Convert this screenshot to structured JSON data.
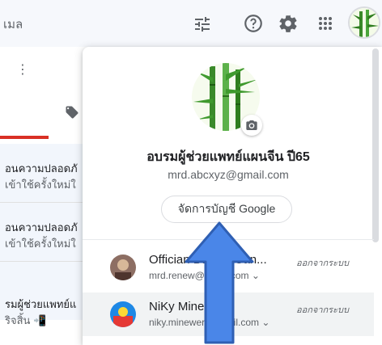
{
  "topbar": {
    "search_placeholder": "เมล",
    "icons": [
      "tune-icon",
      "help-icon",
      "gear-icon",
      "apps-icon",
      "avatar"
    ]
  },
  "inbox": {
    "rows": [
      {
        "line1": "อนความปลอดภั",
        "line2": "เข้าใช้ครั้งใหม่ใ"
      },
      {
        "line1": "อนความปลอดภั",
        "line2": "เข้าใช้ครั้งใหม่ใ"
      },
      {
        "line1": "รมผู้ช่วยแพทย์แ",
        "line2": "ริจสิ้น 📲"
      }
    ]
  },
  "account": {
    "name": "อบรมผู้ช่วยแพทย์แผนจีน ปี65",
    "email": "mrd.abcxyz@gmail.com",
    "manage_label": "จัดการบัญชี Google"
  },
  "other_accounts": [
    {
      "name": "Offician Bu... of San...",
      "email": "mrd.renew@gmail.com",
      "status": "ออกจากระบบ"
    },
    {
      "name": "NiKy MineWer",
      "email": "niky.minewer@gmail.com",
      "status": "ออกจากระบบ"
    }
  ],
  "colors": {
    "accent_red": "#d93025",
    "arrow_blue": "#4a86e8"
  }
}
